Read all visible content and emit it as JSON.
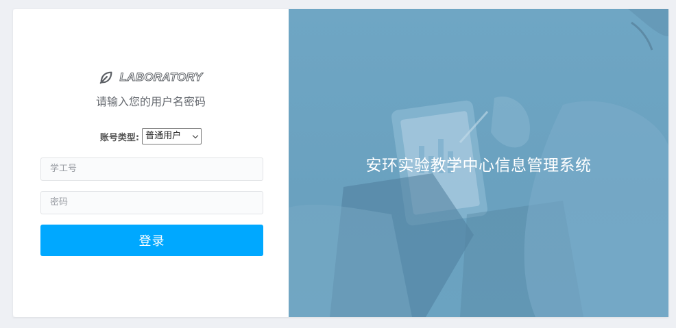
{
  "brand": {
    "name": "LABORATORY",
    "icon": "leaf-icon"
  },
  "login": {
    "subtitle": "请输入您的用户名密码",
    "account_type_label": "账号类型:",
    "account_type_selected": "普通用户",
    "username_placeholder": "学工号",
    "password_placeholder": "密码",
    "submit_label": "登录"
  },
  "hero": {
    "title": "安环实验教学中心信息管理系统"
  },
  "colors": {
    "accent": "#00a8ff",
    "hero_bg": "#6ba3c1"
  }
}
